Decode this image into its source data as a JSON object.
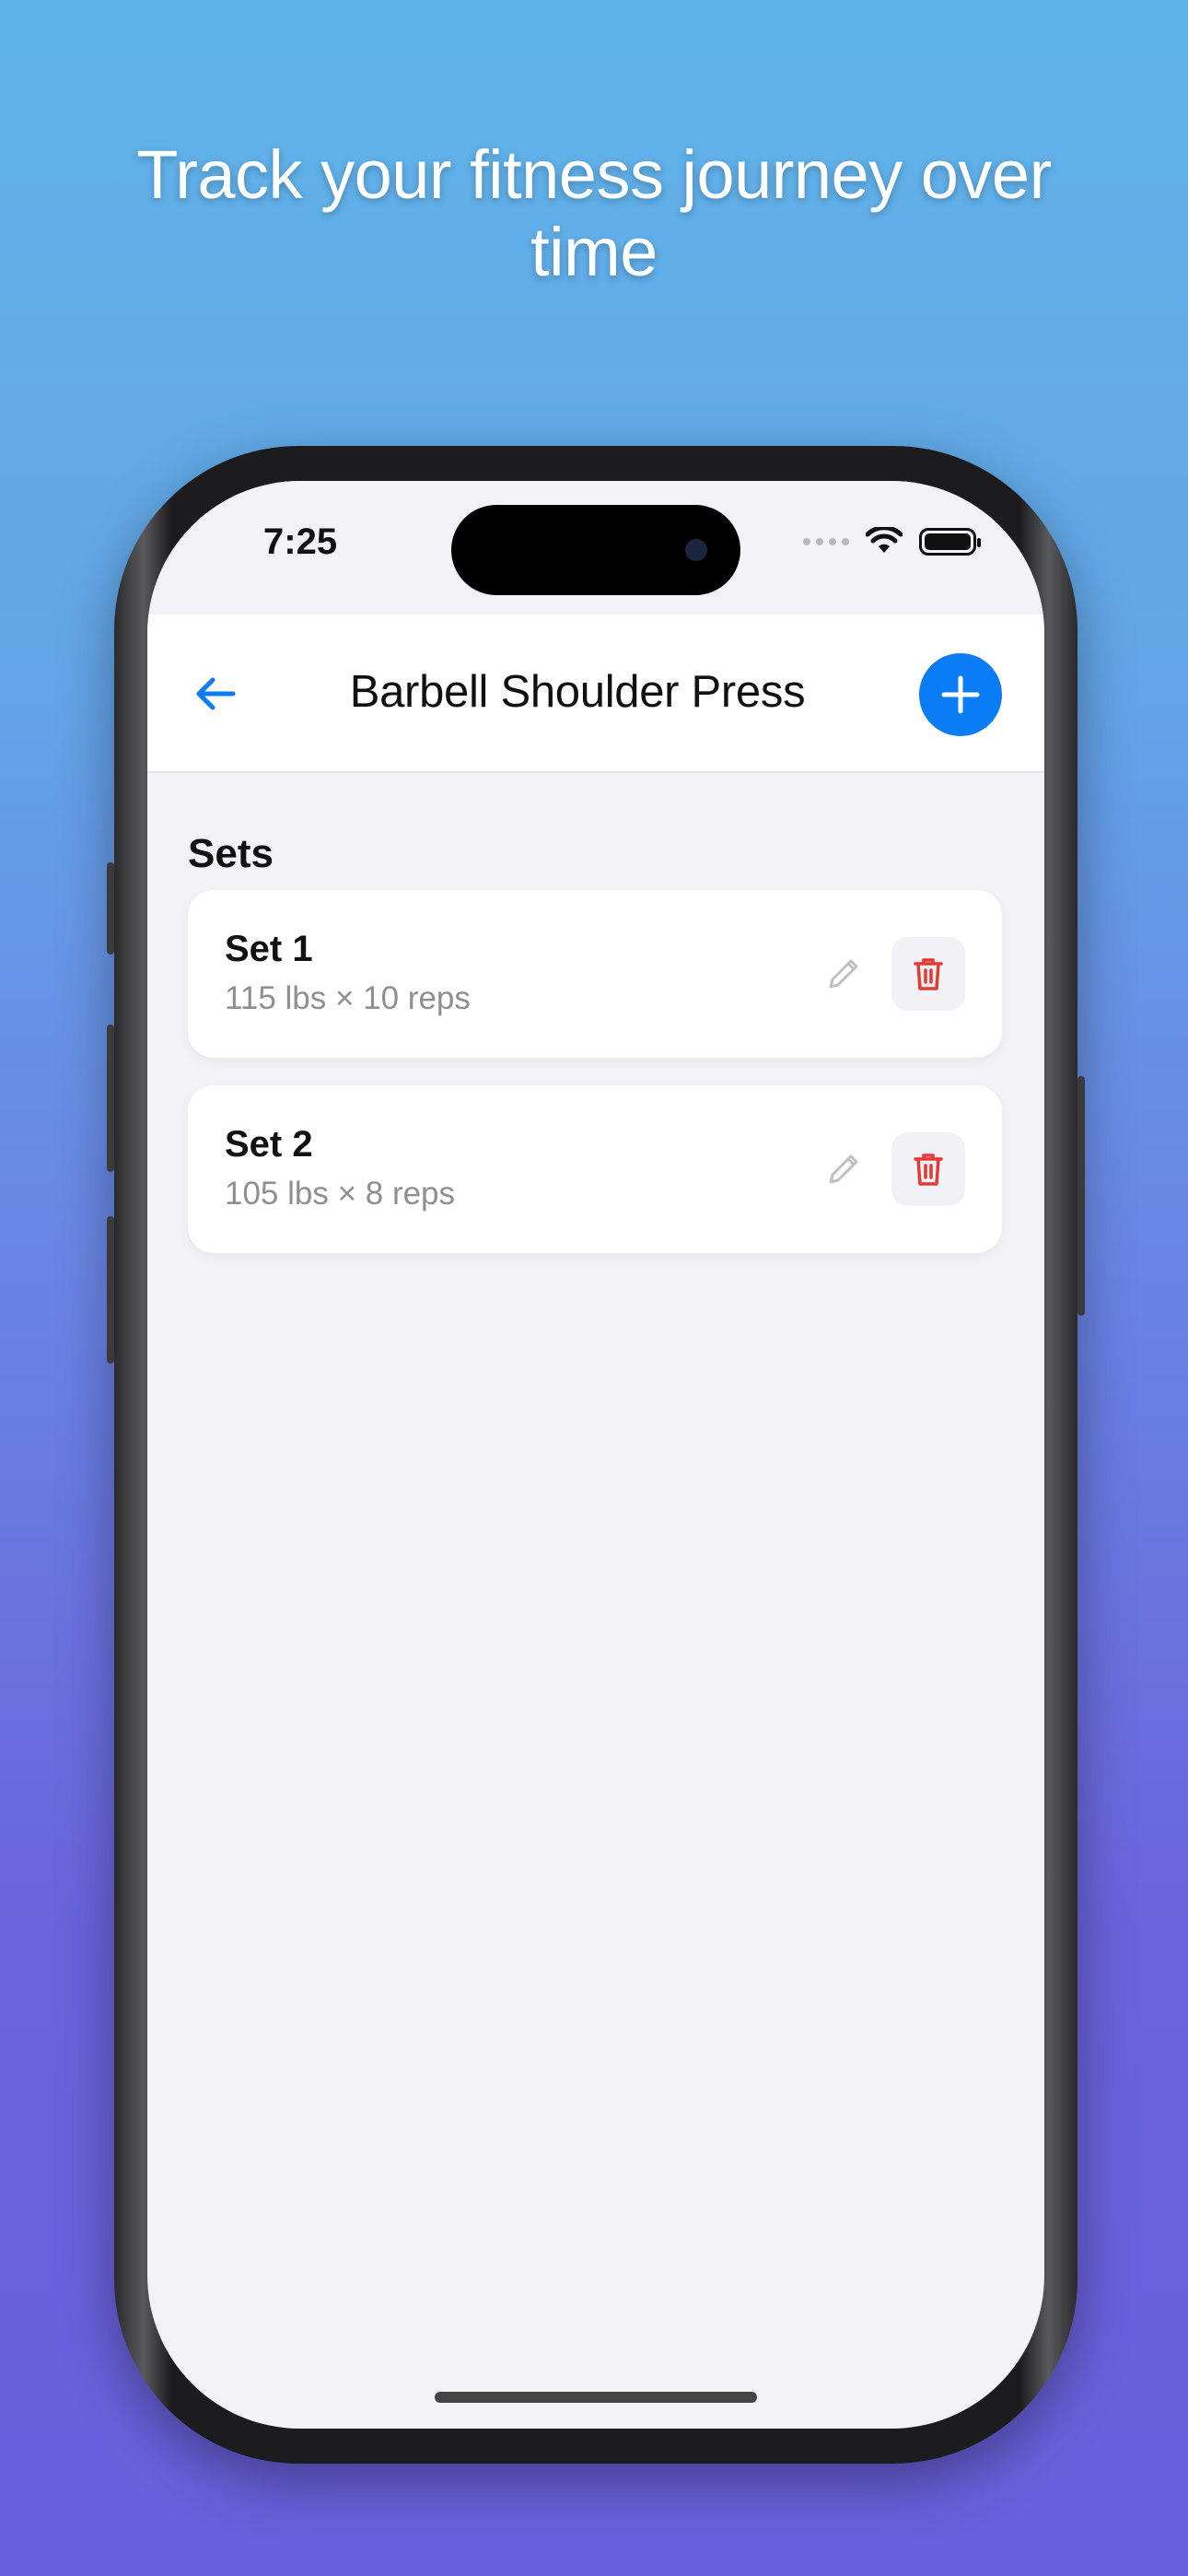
{
  "headline": "Track your fitness journey over time",
  "status_bar": {
    "time": "7:25"
  },
  "navbar": {
    "title": "Barbell Shoulder Press"
  },
  "section_title": "Sets",
  "sets": [
    {
      "name": "Set 1",
      "detail": "115 lbs × 10 reps"
    },
    {
      "name": "Set 2",
      "detail": "105 lbs × 8 reps"
    }
  ],
  "colors": {
    "accent": "#0a7cf5",
    "danger": "#e53935",
    "muted_text": "#8e8e93",
    "background": "#f2f2f7"
  },
  "icons": {
    "back": "arrow-left-icon",
    "add": "plus-icon",
    "edit": "pencil-icon",
    "delete": "trash-icon"
  }
}
